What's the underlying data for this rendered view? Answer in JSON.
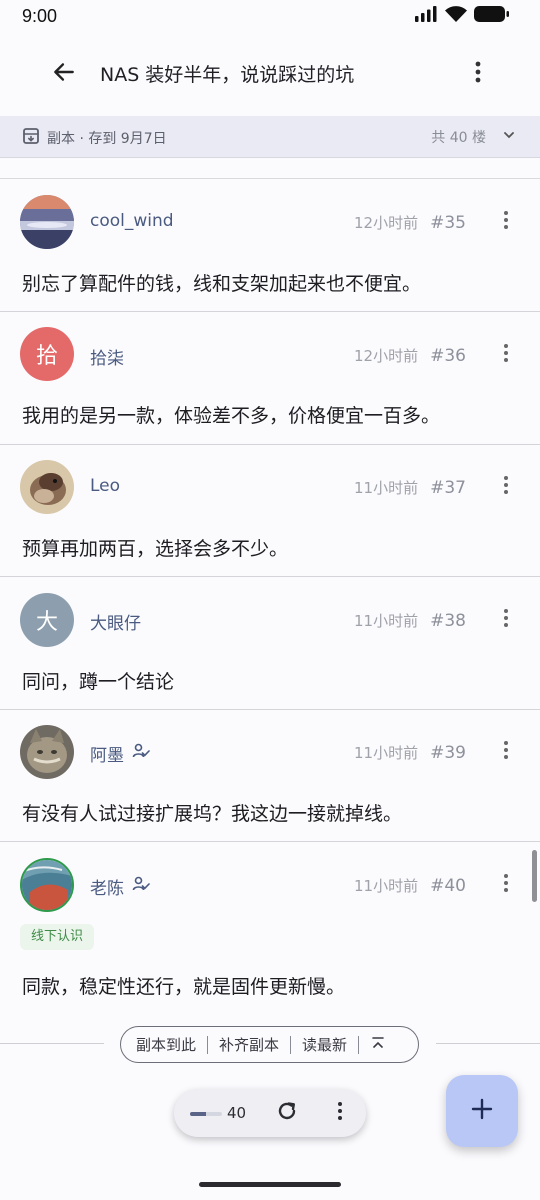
{
  "status_bar": {
    "time": "9:00"
  },
  "app_bar": {
    "title": "NAS 装好半年，说说踩过的坑"
  },
  "archive_bar": {
    "label": "副本 · 存到 9月7日",
    "total": "共 40 楼"
  },
  "posts": [
    {
      "username": "cool_wind",
      "time": "12小时前",
      "floor": "#35",
      "content": "别忘了算配件的钱，线和支架加起来也不便宜。",
      "avatar": "landscape-photo"
    },
    {
      "username": "拾柒",
      "time": "12小时前",
      "floor": "#36",
      "content": "我用的是另一款，体验差不多，价格便宜一百多。",
      "avatar_letter": "拾",
      "avatar_color": "#e46a6a"
    },
    {
      "username": "Leo",
      "time": "11小时前",
      "floor": "#37",
      "content": "预算再加两百，选择会多不少。",
      "avatar": "bird-photo"
    },
    {
      "username": "大眼仔",
      "time": "11小时前",
      "floor": "#38",
      "content": "同问，蹲一个结论",
      "avatar_letter": "大",
      "avatar_color": "#8d9fae"
    },
    {
      "username": "阿墨",
      "time": "11小时前",
      "floor": "#39",
      "content": "有没有人试过接扩展坞？我这边一接就掉线。",
      "avatar": "cat-photo",
      "verified": true
    },
    {
      "username": "老陈",
      "time": "11小时前",
      "floor": "#40",
      "content": "同款，稳定性还行，就是固件更新慢。",
      "avatar": "wave-painting",
      "verified": true,
      "tag": "线下认识"
    }
  ],
  "actions": {
    "save_copy": "副本到此",
    "fill_copy": "补齐副本",
    "read_latest": "读最新"
  },
  "bottom_bar": {
    "count": "40",
    "progress": 0.5
  },
  "colors": {
    "accent": "#b8c7f6",
    "username": "#4a5a80",
    "tag_bg": "#ebf5ec",
    "tag_text": "#3e8a46"
  },
  "icons": {
    "back": "arrow-left-icon",
    "more": "more-vertical-icon",
    "archive": "archive-box-icon",
    "expand": "chevron-down-icon",
    "verified": "user-check-icon",
    "collapse": "collapse-up-icon",
    "refresh": "refresh-icon",
    "add": "plus-icon"
  }
}
